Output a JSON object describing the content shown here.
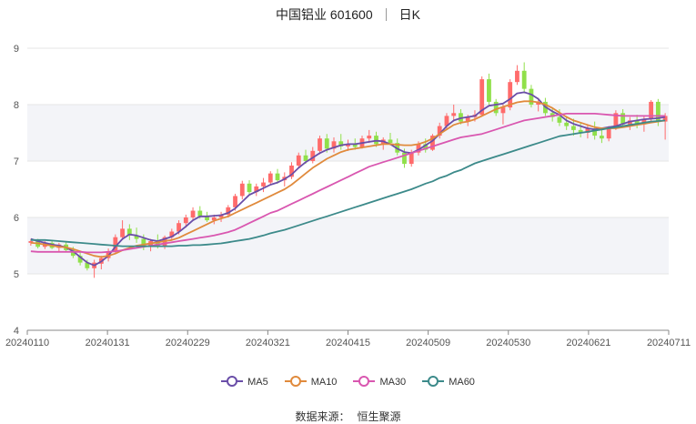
{
  "header": {
    "stock_name": "中国铝业 601600",
    "period": "日K"
  },
  "footer": {
    "source_label": "数据来源：",
    "source_name": "恒生聚源"
  },
  "chart_data": {
    "type": "candlestick",
    "ylim": [
      4,
      9
    ],
    "yticks": [
      4,
      5,
      6,
      7,
      8,
      9
    ],
    "xticks": [
      "20240110",
      "20240131",
      "20240229",
      "20240321",
      "20240415",
      "20240509",
      "20240530",
      "20240621",
      "20240711"
    ],
    "colors": {
      "up": "#ff6b6b",
      "down": "#90e04a",
      "MA5": "#6a4ea8",
      "MA10": "#e08a3c",
      "MA30": "#d957b0",
      "MA60": "#3c8a8a",
      "band": "#f3f4f8",
      "grid": "#e6e6e6",
      "axis": "#888888"
    },
    "candles": [
      {
        "o": 5.55,
        "h": 5.62,
        "l": 5.5,
        "c": 5.58
      },
      {
        "o": 5.58,
        "h": 5.62,
        "l": 5.45,
        "c": 5.48
      },
      {
        "o": 5.48,
        "h": 5.58,
        "l": 5.44,
        "c": 5.55
      },
      {
        "o": 5.55,
        "h": 5.6,
        "l": 5.44,
        "c": 5.46
      },
      {
        "o": 5.46,
        "h": 5.55,
        "l": 5.4,
        "c": 5.52
      },
      {
        "o": 5.52,
        "h": 5.56,
        "l": 5.4,
        "c": 5.42
      },
      {
        "o": 5.42,
        "h": 5.48,
        "l": 5.28,
        "c": 5.32
      },
      {
        "o": 5.32,
        "h": 5.38,
        "l": 5.15,
        "c": 5.2
      },
      {
        "o": 5.2,
        "h": 5.25,
        "l": 5.06,
        "c": 5.1
      },
      {
        "o": 5.1,
        "h": 5.25,
        "l": 4.93,
        "c": 5.2
      },
      {
        "o": 5.18,
        "h": 5.32,
        "l": 5.08,
        "c": 5.28
      },
      {
        "o": 5.28,
        "h": 5.45,
        "l": 5.22,
        "c": 5.4
      },
      {
        "o": 5.4,
        "h": 5.7,
        "l": 5.35,
        "c": 5.65
      },
      {
        "o": 5.65,
        "h": 5.95,
        "l": 5.6,
        "c": 5.8
      },
      {
        "o": 5.8,
        "h": 5.88,
        "l": 5.6,
        "c": 5.68
      },
      {
        "o": 5.68,
        "h": 5.82,
        "l": 5.55,
        "c": 5.62
      },
      {
        "o": 5.62,
        "h": 5.7,
        "l": 5.42,
        "c": 5.5
      },
      {
        "o": 5.5,
        "h": 5.62,
        "l": 5.4,
        "c": 5.58
      },
      {
        "o": 5.58,
        "h": 5.7,
        "l": 5.45,
        "c": 5.48
      },
      {
        "o": 5.48,
        "h": 5.68,
        "l": 5.44,
        "c": 5.65
      },
      {
        "o": 5.65,
        "h": 5.8,
        "l": 5.6,
        "c": 5.75
      },
      {
        "o": 5.75,
        "h": 5.95,
        "l": 5.7,
        "c": 5.9
      },
      {
        "o": 5.9,
        "h": 6.05,
        "l": 5.82,
        "c": 6.0
      },
      {
        "o": 6.0,
        "h": 6.18,
        "l": 5.95,
        "c": 6.12
      },
      {
        "o": 6.12,
        "h": 6.2,
        "l": 5.98,
        "c": 6.02
      },
      {
        "o": 6.02,
        "h": 6.1,
        "l": 5.92,
        "c": 5.95
      },
      {
        "o": 5.95,
        "h": 6.05,
        "l": 5.88,
        "c": 6.0
      },
      {
        "o": 6.0,
        "h": 6.1,
        "l": 5.92,
        "c": 6.05
      },
      {
        "o": 6.05,
        "h": 6.22,
        "l": 6.0,
        "c": 6.18
      },
      {
        "o": 6.18,
        "h": 6.42,
        "l": 6.12,
        "c": 6.38
      },
      {
        "o": 6.38,
        "h": 6.65,
        "l": 6.32,
        "c": 6.6
      },
      {
        "o": 6.6,
        "h": 6.66,
        "l": 6.4,
        "c": 6.45
      },
      {
        "o": 6.45,
        "h": 6.6,
        "l": 6.38,
        "c": 6.55
      },
      {
        "o": 6.55,
        "h": 6.7,
        "l": 6.45,
        "c": 6.62
      },
      {
        "o": 6.62,
        "h": 6.82,
        "l": 6.58,
        "c": 6.78
      },
      {
        "o": 6.78,
        "h": 6.86,
        "l": 6.6,
        "c": 6.66
      },
      {
        "o": 6.66,
        "h": 6.8,
        "l": 6.55,
        "c": 6.72
      },
      {
        "o": 6.72,
        "h": 6.98,
        "l": 6.68,
        "c": 6.92
      },
      {
        "o": 6.92,
        "h": 7.15,
        "l": 6.88,
        "c": 7.1
      },
      {
        "o": 7.1,
        "h": 7.2,
        "l": 6.95,
        "c": 7.0
      },
      {
        "o": 7.0,
        "h": 7.25,
        "l": 6.96,
        "c": 7.18
      },
      {
        "o": 7.18,
        "h": 7.45,
        "l": 7.12,
        "c": 7.4
      },
      {
        "o": 7.4,
        "h": 7.48,
        "l": 7.15,
        "c": 7.22
      },
      {
        "o": 7.22,
        "h": 7.42,
        "l": 7.15,
        "c": 7.35
      },
      {
        "o": 7.35,
        "h": 7.48,
        "l": 7.2,
        "c": 7.26
      },
      {
        "o": 7.26,
        "h": 7.38,
        "l": 7.18,
        "c": 7.3
      },
      {
        "o": 7.3,
        "h": 7.4,
        "l": 7.2,
        "c": 7.25
      },
      {
        "o": 7.25,
        "h": 7.45,
        "l": 7.22,
        "c": 7.4
      },
      {
        "o": 7.4,
        "h": 7.55,
        "l": 7.32,
        "c": 7.45
      },
      {
        "o": 7.45,
        "h": 7.52,
        "l": 7.25,
        "c": 7.3
      },
      {
        "o": 7.3,
        "h": 7.42,
        "l": 7.2,
        "c": 7.38
      },
      {
        "o": 7.38,
        "h": 7.5,
        "l": 7.28,
        "c": 7.32
      },
      {
        "o": 7.32,
        "h": 7.4,
        "l": 7.1,
        "c": 7.15
      },
      {
        "o": 7.15,
        "h": 7.22,
        "l": 6.88,
        "c": 6.95
      },
      {
        "o": 6.95,
        "h": 7.2,
        "l": 6.9,
        "c": 7.15
      },
      {
        "o": 7.15,
        "h": 7.35,
        "l": 7.1,
        "c": 7.3
      },
      {
        "o": 7.3,
        "h": 7.4,
        "l": 7.15,
        "c": 7.2
      },
      {
        "o": 7.2,
        "h": 7.48,
        "l": 7.18,
        "c": 7.45
      },
      {
        "o": 7.45,
        "h": 7.68,
        "l": 7.4,
        "c": 7.62
      },
      {
        "o": 7.62,
        "h": 7.85,
        "l": 7.55,
        "c": 7.8
      },
      {
        "o": 7.8,
        "h": 8.0,
        "l": 7.7,
        "c": 7.85
      },
      {
        "o": 7.85,
        "h": 7.92,
        "l": 7.65,
        "c": 7.7
      },
      {
        "o": 7.7,
        "h": 7.82,
        "l": 7.62,
        "c": 7.78
      },
      {
        "o": 7.78,
        "h": 7.9,
        "l": 7.7,
        "c": 7.82
      },
      {
        "o": 7.82,
        "h": 8.5,
        "l": 7.8,
        "c": 8.45
      },
      {
        "o": 8.45,
        "h": 8.55,
        "l": 8.0,
        "c": 8.05
      },
      {
        "o": 8.05,
        "h": 8.1,
        "l": 7.8,
        "c": 7.85
      },
      {
        "o": 7.85,
        "h": 8.0,
        "l": 7.65,
        "c": 7.95
      },
      {
        "o": 7.95,
        "h": 8.45,
        "l": 7.9,
        "c": 8.4
      },
      {
        "o": 8.4,
        "h": 8.7,
        "l": 8.35,
        "c": 8.6
      },
      {
        "o": 8.6,
        "h": 8.75,
        "l": 8.2,
        "c": 8.28
      },
      {
        "o": 8.28,
        "h": 8.35,
        "l": 7.95,
        "c": 8.0
      },
      {
        "o": 8.0,
        "h": 8.12,
        "l": 7.88,
        "c": 8.05
      },
      {
        "o": 8.05,
        "h": 8.12,
        "l": 7.8,
        "c": 7.85
      },
      {
        "o": 7.85,
        "h": 7.95,
        "l": 7.7,
        "c": 7.78
      },
      {
        "o": 7.78,
        "h": 7.92,
        "l": 7.62,
        "c": 7.68
      },
      {
        "o": 7.68,
        "h": 7.8,
        "l": 7.55,
        "c": 7.62
      },
      {
        "o": 7.62,
        "h": 7.75,
        "l": 7.45,
        "c": 7.55
      },
      {
        "o": 7.55,
        "h": 7.68,
        "l": 7.42,
        "c": 7.5
      },
      {
        "o": 7.5,
        "h": 7.65,
        "l": 7.4,
        "c": 7.58
      },
      {
        "o": 7.58,
        "h": 7.7,
        "l": 7.38,
        "c": 7.45
      },
      {
        "o": 7.45,
        "h": 7.55,
        "l": 7.32,
        "c": 7.4
      },
      {
        "o": 7.4,
        "h": 7.62,
        "l": 7.35,
        "c": 7.58
      },
      {
        "o": 7.58,
        "h": 7.9,
        "l": 7.55,
        "c": 7.85
      },
      {
        "o": 7.85,
        "h": 7.92,
        "l": 7.6,
        "c": 7.65
      },
      {
        "o": 7.65,
        "h": 7.78,
        "l": 7.55,
        "c": 7.72
      },
      {
        "o": 7.72,
        "h": 7.82,
        "l": 7.58,
        "c": 7.65
      },
      {
        "o": 7.65,
        "h": 7.8,
        "l": 7.52,
        "c": 7.75
      },
      {
        "o": 7.75,
        "h": 8.08,
        "l": 7.7,
        "c": 8.05
      },
      {
        "o": 8.05,
        "h": 8.1,
        "l": 7.62,
        "c": 7.7
      },
      {
        "o": 7.7,
        "h": 7.85,
        "l": 7.38,
        "c": 7.8
      }
    ],
    "series": [
      {
        "name": "MA5",
        "values": [
          5.62,
          5.58,
          5.55,
          5.52,
          5.5,
          5.47,
          5.4,
          5.3,
          5.2,
          5.15,
          5.22,
          5.32,
          5.48,
          5.62,
          5.7,
          5.68,
          5.64,
          5.6,
          5.58,
          5.62,
          5.66,
          5.74,
          5.84,
          5.95,
          6.02,
          6.02,
          6.03,
          6.04,
          6.08,
          6.16,
          6.28,
          6.4,
          6.46,
          6.52,
          6.58,
          6.62,
          6.68,
          6.76,
          6.88,
          6.98,
          7.06,
          7.14,
          7.2,
          7.24,
          7.28,
          7.3,
          7.3,
          7.32,
          7.34,
          7.36,
          7.35,
          7.3,
          7.22,
          7.16,
          7.14,
          7.2,
          7.28,
          7.36,
          7.48,
          7.62,
          7.72,
          7.76,
          7.78,
          7.8,
          7.9,
          7.98,
          8.0,
          8.02,
          8.1,
          8.2,
          8.22,
          8.18,
          8.1,
          7.96,
          7.88,
          7.82,
          7.72,
          7.66,
          7.62,
          7.58,
          7.56,
          7.58,
          7.6,
          7.62,
          7.66,
          7.7,
          7.72,
          7.74,
          7.75,
          7.76,
          7.78
        ]
      },
      {
        "name": "MA10",
        "values": [
          5.55,
          5.54,
          5.52,
          5.5,
          5.48,
          5.47,
          5.44,
          5.4,
          5.36,
          5.32,
          5.3,
          5.32,
          5.36,
          5.42,
          5.46,
          5.5,
          5.52,
          5.54,
          5.56,
          5.58,
          5.6,
          5.64,
          5.7,
          5.76,
          5.82,
          5.88,
          5.94,
          5.98,
          6.02,
          6.08,
          6.14,
          6.2,
          6.26,
          6.32,
          6.38,
          6.44,
          6.5,
          6.58,
          6.68,
          6.78,
          6.88,
          6.96,
          7.04,
          7.1,
          7.16,
          7.2,
          7.22,
          7.24,
          7.26,
          7.28,
          7.3,
          7.3,
          7.29,
          7.28,
          7.28,
          7.3,
          7.34,
          7.4,
          7.48,
          7.56,
          7.64,
          7.68,
          7.7,
          7.74,
          7.8,
          7.86,
          7.92,
          7.96,
          8.0,
          8.04,
          8.06,
          8.06,
          8.04,
          8.0,
          7.94,
          7.86,
          7.78,
          7.72,
          7.68,
          7.64,
          7.6,
          7.58,
          7.58,
          7.58,
          7.6,
          7.62,
          7.64,
          7.66,
          7.68,
          7.7,
          7.72
        ]
      },
      {
        "name": "MA30",
        "values": [
          5.4,
          5.39,
          5.39,
          5.39,
          5.39,
          5.39,
          5.39,
          5.39,
          5.38,
          5.38,
          5.38,
          5.39,
          5.4,
          5.42,
          5.44,
          5.46,
          5.48,
          5.5,
          5.52,
          5.54,
          5.56,
          5.58,
          5.6,
          5.62,
          5.64,
          5.66,
          5.68,
          5.71,
          5.74,
          5.78,
          5.84,
          5.9,
          5.96,
          6.02,
          6.08,
          6.12,
          6.18,
          6.24,
          6.3,
          6.36,
          6.42,
          6.48,
          6.54,
          6.6,
          6.66,
          6.72,
          6.78,
          6.84,
          6.9,
          6.94,
          6.98,
          7.02,
          7.06,
          7.1,
          7.14,
          7.18,
          7.22,
          7.26,
          7.3,
          7.34,
          7.38,
          7.42,
          7.44,
          7.46,
          7.48,
          7.52,
          7.56,
          7.6,
          7.64,
          7.68,
          7.72,
          7.74,
          7.76,
          7.78,
          7.8,
          7.82,
          7.84,
          7.84,
          7.84,
          7.84,
          7.84,
          7.83,
          7.82,
          7.81,
          7.8,
          7.8,
          7.8,
          7.8,
          7.8,
          7.8,
          7.8
        ]
      },
      {
        "name": "MA60",
        "values": [
          5.6,
          5.6,
          5.6,
          5.59,
          5.58,
          5.57,
          5.56,
          5.55,
          5.54,
          5.53,
          5.52,
          5.51,
          5.5,
          5.49,
          5.49,
          5.49,
          5.49,
          5.49,
          5.49,
          5.49,
          5.49,
          5.5,
          5.5,
          5.51,
          5.51,
          5.52,
          5.53,
          5.54,
          5.56,
          5.58,
          5.6,
          5.62,
          5.65,
          5.68,
          5.72,
          5.75,
          5.78,
          5.82,
          5.86,
          5.9,
          5.94,
          5.98,
          6.02,
          6.06,
          6.1,
          6.14,
          6.18,
          6.22,
          6.26,
          6.3,
          6.34,
          6.38,
          6.42,
          6.46,
          6.5,
          6.55,
          6.6,
          6.64,
          6.7,
          6.74,
          6.8,
          6.84,
          6.9,
          6.96,
          7.0,
          7.04,
          7.08,
          7.12,
          7.16,
          7.2,
          7.24,
          7.28,
          7.32,
          7.36,
          7.4,
          7.44,
          7.46,
          7.48,
          7.5,
          7.52,
          7.54,
          7.56,
          7.58,
          7.6,
          7.62,
          7.64,
          7.66,
          7.68,
          7.7,
          7.71,
          7.72
        ]
      }
    ]
  }
}
